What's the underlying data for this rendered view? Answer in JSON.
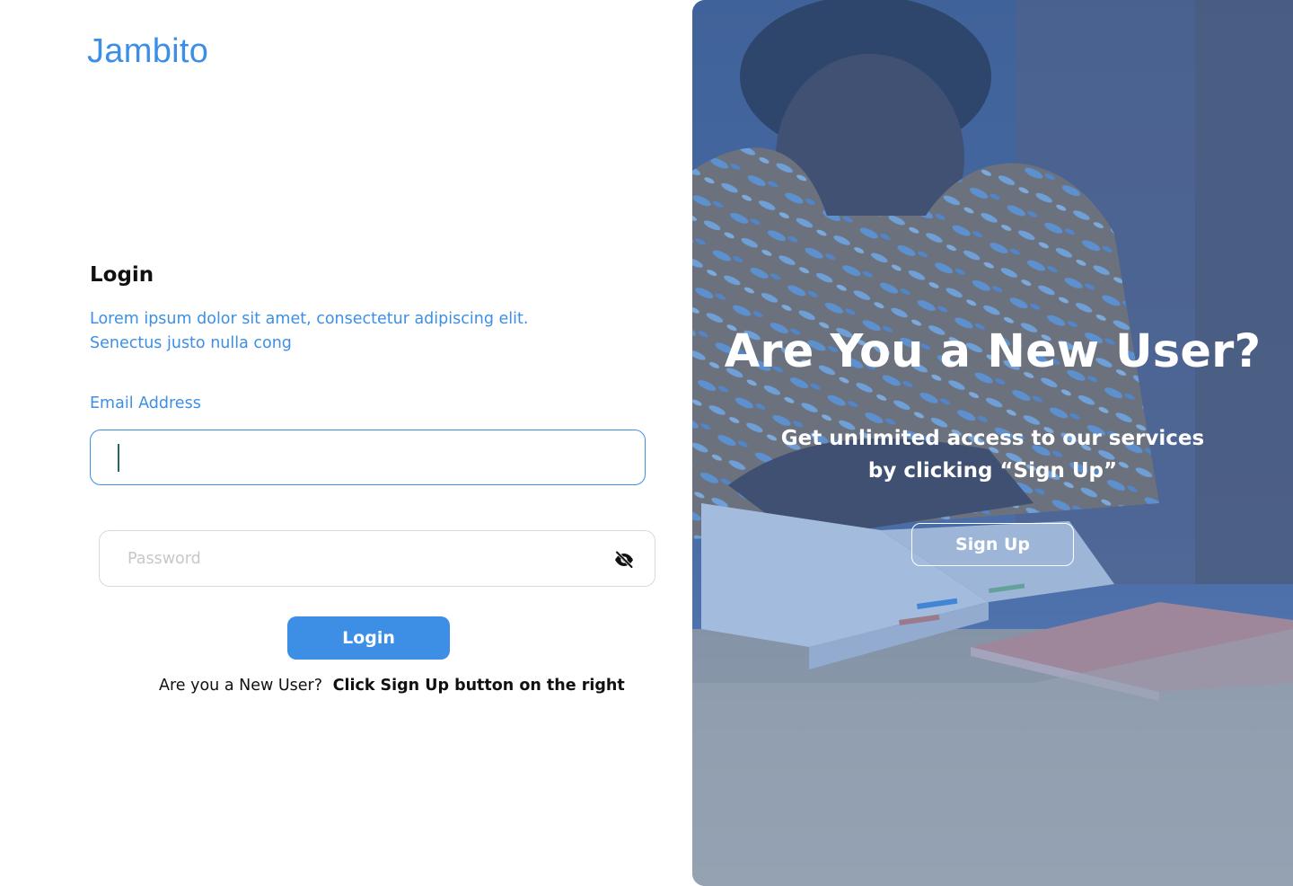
{
  "brand": {
    "logo_text": "Jambito",
    "accent_color": "#3d8fe6"
  },
  "login": {
    "title": "Login",
    "intro_line1": "Lorem ipsum dolor sit amet, consectetur adipiscing elit.",
    "intro_line2": "Senectus justo nulla cong",
    "email_label": "Email Address",
    "email_value": "",
    "password_placeholder": "Password",
    "password_toggle_icon": "eye-off-icon",
    "submit_label": "Login",
    "new_user_prompt": "Are you a New User?",
    "new_user_hint": "Click Sign Up button on the right"
  },
  "hero": {
    "title": "Are You a New User?",
    "subtitle_line1": "Get unlimited access to our services",
    "subtitle_line2": "by clicking “Sign Up”",
    "cta_label": "Sign Up",
    "overlay_color": "#487ac4"
  }
}
